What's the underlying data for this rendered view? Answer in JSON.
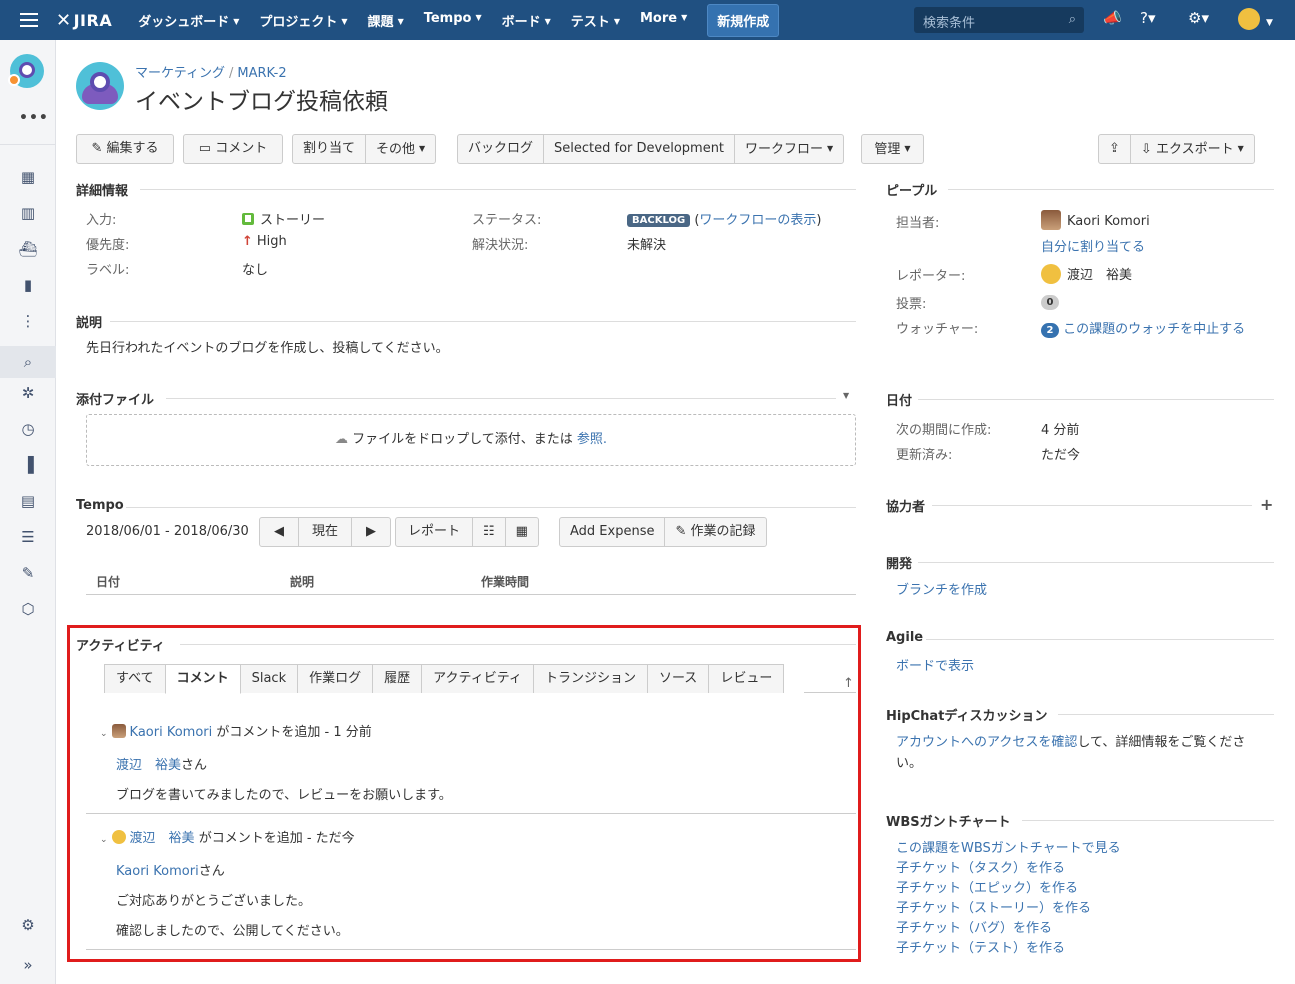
{
  "topnav": {
    "logo": "JIRA",
    "menu": [
      "ダッシュボード",
      "プロジェクト",
      "課題",
      "Tempo",
      "ボード",
      "テスト",
      "More"
    ],
    "create": "新規作成",
    "search_placeholder": "検索条件"
  },
  "issue": {
    "breadcrumb_project": "マーケティング",
    "breadcrumb_key": "MARK-2",
    "title": "イベントブログ投稿依頼"
  },
  "toolbar": {
    "edit": "編集する",
    "comment": "コメント",
    "assign": "割り当て",
    "other": "その他",
    "backlog": "バックログ",
    "selected": "Selected for Development",
    "workflow": "ワークフロー",
    "admin": "管理",
    "export": "エクスポート"
  },
  "details": {
    "heading": "詳細情報",
    "type_label": "入力:",
    "type_value": "ストーリー",
    "priority_label": "優先度:",
    "priority_value": "High",
    "labels_label": "ラベル:",
    "labels_value": "なし",
    "status_label": "ステータス:",
    "status_value": "BACKLOG",
    "workflow_link": "ワークフローの表示",
    "resolution_label": "解決状況:",
    "resolution_value": "未解決"
  },
  "description": {
    "heading": "説明",
    "text": "先日行われたイベントのブログを作成し、投稿してください。"
  },
  "attachments": {
    "heading": "添付ファイル",
    "drop_text": "ファイルをドロップして添付、または",
    "browse": "参照."
  },
  "tempo": {
    "heading": "Tempo",
    "range": "2018/06/01 - 2018/06/30",
    "now": "現在",
    "report": "レポート",
    "add_expense": "Add Expense",
    "log_work": "作業の記録",
    "columns": [
      "日付",
      "説明",
      "作業時間"
    ]
  },
  "activity": {
    "heading": "アクティビティ",
    "tabs": [
      "すべて",
      "コメント",
      "Slack",
      "作業ログ",
      "履歴",
      "アクティビティ",
      "トランジション",
      "ソース",
      "レビュー"
    ],
    "comments": [
      {
        "author": "Kaori Komori",
        "action": "がコメントを追加 - 1 分前",
        "mention": "渡辺　裕美",
        "suffix": "さん",
        "lines": [
          "ブログを書いてみましたので、レビューをお願いします。"
        ]
      },
      {
        "author": "渡辺　裕美",
        "action": "がコメントを追加 - ただ今",
        "mention": "Kaori Komori",
        "suffix": "さん",
        "lines": [
          "ご対応ありがとうございました。",
          "確認しましたので、公開してください。"
        ]
      }
    ]
  },
  "people": {
    "heading": "ピープル",
    "assignee_label": "担当者:",
    "assignee": "Kaori Komori",
    "assign_me": "自分に割り当てる",
    "reporter_label": "レポーター:",
    "reporter": "渡辺　裕美",
    "votes_label": "投票:",
    "votes": "0",
    "watchers_label": "ウォッチャー:",
    "watchers": "2",
    "stop_watch": "この課題のウォッチを中止する"
  },
  "dates": {
    "heading": "日付",
    "created_label": "次の期間に作成:",
    "created": "4 分前",
    "updated_label": "更新済み:",
    "updated": "ただ今"
  },
  "collaborators": {
    "heading": "協力者"
  },
  "dev": {
    "heading": "開発",
    "link": "ブランチを作成"
  },
  "agile": {
    "heading": "Agile",
    "link": "ボードで表示"
  },
  "hipchat": {
    "heading": "HipChatディスカッション",
    "link": "アカウントへのアクセスを確認",
    "text1": "して、詳細情報をご覧くださ",
    "text2": "い。"
  },
  "wbs": {
    "heading": "WBSガントチャート",
    "links": [
      "この課題をWBSガントチャートで見る",
      "子チケット（タスク）を作る",
      "子チケット（エピック）を作る",
      "子チケット（ストーリー）を作る",
      "子チケット（バグ）を作る",
      "子チケット（テスト）を作る"
    ]
  }
}
